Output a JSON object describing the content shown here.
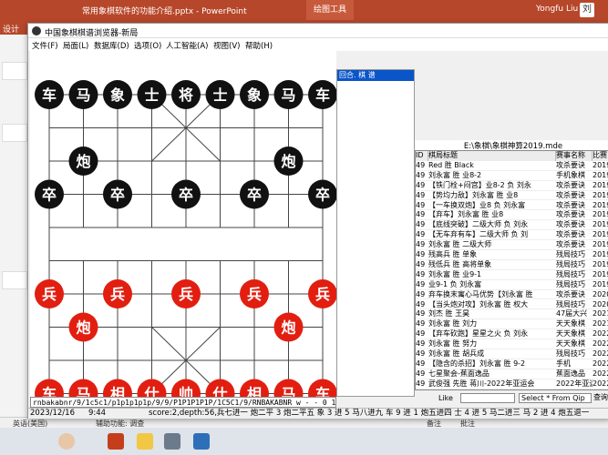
{
  "ppt": {
    "title": "常用象棋软件的功能介绍.pptx  -  PowerPoint",
    "draw_tools": "绘图工具",
    "user": "Yongfu Liu",
    "avatar_text": "刘",
    "ribbon_tab": "设计",
    "status_lang": "英语(美国)",
    "status_access": "辅助功能: 调查",
    "status_notes": "备注",
    "status_comments": "批注"
  },
  "app": {
    "title": "中国象棋棋谱浏览器-新局",
    "menu": [
      "文件(F)",
      "局面(L)",
      "数据库(D)",
      "选项(O)",
      "人工智能(A)",
      "视图(V)",
      "帮助(H)"
    ],
    "movelist_header": "回合.    棋    谱"
  },
  "board": {
    "black_pieces": [
      {
        "ch": "车",
        "col": 0,
        "row": 0
      },
      {
        "ch": "马",
        "col": 1,
        "row": 0
      },
      {
        "ch": "象",
        "col": 2,
        "row": 0
      },
      {
        "ch": "士",
        "col": 3,
        "row": 0
      },
      {
        "ch": "将",
        "col": 4,
        "row": 0
      },
      {
        "ch": "士",
        "col": 5,
        "row": 0
      },
      {
        "ch": "象",
        "col": 6,
        "row": 0
      },
      {
        "ch": "马",
        "col": 7,
        "row": 0
      },
      {
        "ch": "车",
        "col": 8,
        "row": 0
      },
      {
        "ch": "炮",
        "col": 1,
        "row": 2
      },
      {
        "ch": "炮",
        "col": 7,
        "row": 2
      },
      {
        "ch": "卒",
        "col": 0,
        "row": 3
      },
      {
        "ch": "卒",
        "col": 2,
        "row": 3
      },
      {
        "ch": "卒",
        "col": 4,
        "row": 3
      },
      {
        "ch": "卒",
        "col": 6,
        "row": 3
      },
      {
        "ch": "卒",
        "col": 8,
        "row": 3
      }
    ],
    "red_pieces": [
      {
        "ch": "兵",
        "col": 0,
        "row": 6
      },
      {
        "ch": "兵",
        "col": 2,
        "row": 6
      },
      {
        "ch": "兵",
        "col": 4,
        "row": 6
      },
      {
        "ch": "兵",
        "col": 6,
        "row": 6
      },
      {
        "ch": "兵",
        "col": 8,
        "row": 6
      },
      {
        "ch": "炮",
        "col": 1,
        "row": 7
      },
      {
        "ch": "炮",
        "col": 7,
        "row": 7
      },
      {
        "ch": "车",
        "col": 0,
        "row": 9
      },
      {
        "ch": "马",
        "col": 1,
        "row": 9
      },
      {
        "ch": "相",
        "col": 2,
        "row": 9
      },
      {
        "ch": "仕",
        "col": 3,
        "row": 9
      },
      {
        "ch": "帅",
        "col": 4,
        "row": 9
      },
      {
        "ch": "仕",
        "col": 5,
        "row": 9
      },
      {
        "ch": "相",
        "col": 6,
        "row": 9
      },
      {
        "ch": "马",
        "col": 7,
        "row": 9
      },
      {
        "ch": "车",
        "col": 8,
        "row": 9
      }
    ]
  },
  "db": {
    "path": "E:\\象棋\\象棋神算2019.mde",
    "headers": [
      "ID",
      "棋局标题",
      "赛事名称",
      "比赛"
    ],
    "rows": [
      [
        "49",
        "Red 胜 Black",
        "攻杀要诀",
        "2019"
      ],
      [
        "49",
        "刘永富 胜 业8-2",
        "手机象棋",
        "2019"
      ],
      [
        "49",
        "【铁门栓+闷宫】业8-2 负 刘永",
        "攻杀要诀",
        "2019"
      ],
      [
        "49",
        "【势均力敌】刘永富 胜 业8",
        "攻杀要诀",
        "2019"
      ],
      [
        "49",
        "【一车换双炮】业8 负 刘永富",
        "攻杀要诀",
        "2019"
      ],
      [
        "49",
        "【弃车】刘永富 胜 业8",
        "攻杀要诀",
        "2019"
      ],
      [
        "49",
        "【底线突破】二级大师 负 刘永",
        "攻杀要诀",
        "2019"
      ],
      [
        "49",
        "【无车弃有车】二级大师 负 刘",
        "攻杀要诀",
        "2019"
      ],
      [
        "49",
        "刘永富 胜 二级大师",
        "攻杀要诀",
        "2019"
      ],
      [
        "49",
        "残高兵 胜 单象",
        "残局技巧",
        "2019"
      ],
      [
        "49",
        "残低兵 胜 高将单象",
        "残局技巧",
        "2019"
      ],
      [
        "49",
        "刘永富 胜 业9-1",
        "残局技巧",
        "2019"
      ],
      [
        "49",
        "业9-1 负 刘永富",
        "残局技巧",
        "2019"
      ],
      [
        "49",
        "弃车换末寓心马优势【刘永富 胜",
        "攻杀要诀",
        "2020"
      ],
      [
        "49",
        "【当头炮对攻】刘永富 胜 权大",
        "残局技巧",
        "2020"
      ],
      [
        "49",
        "刘杰 胜 王昊",
        "47届大兴",
        "2021"
      ],
      [
        "49",
        "刘永富 胜 刘力",
        "天天象棋",
        "2021"
      ],
      [
        "49",
        "【弃车砍跑】星星之火 负 刘永",
        "天天象棋",
        "2022"
      ],
      [
        "49",
        "刘永富 胜 努力",
        "天天象棋",
        "2022"
      ],
      [
        "49",
        "刘永富 胜 胡兵成",
        "残局技巧",
        "2022"
      ],
      [
        "49",
        "【隐含的杀招】刘永富 胜 9-2",
        "手机",
        "2022"
      ],
      [
        "49",
        "七星聚会-蕉面逸品",
        "蕉面逸品",
        "2022"
      ],
      [
        "49",
        "武俊强 先胜 蒋川-2022年亚运会",
        "2022年亚运会",
        "2022"
      ]
    ],
    "like_label": "Like",
    "sql": "Select * From Qip",
    "query_label": "查询"
  },
  "fen": "rnbakabnr/9/1c5c1/p1p1p1p1p/9/9/P1P1P1P1P/1C5C1/9/RNBAKABNR w - - 0 1",
  "status": {
    "date": "2023/12/16",
    "time": "9:44",
    "info": "score:2,depth:56,兵七进一 炮二平 3 炮二平五 象 3 进 5 马八进九 车 9 进 1 炮五进四 士 4 进 5 马二进三 马 2 进 4 炮五退一"
  },
  "colors": {
    "ppt_red": "#b7472a",
    "black_piece": "#111111",
    "red_piece": "#e21e10",
    "select_blue": "#0a55c8"
  }
}
